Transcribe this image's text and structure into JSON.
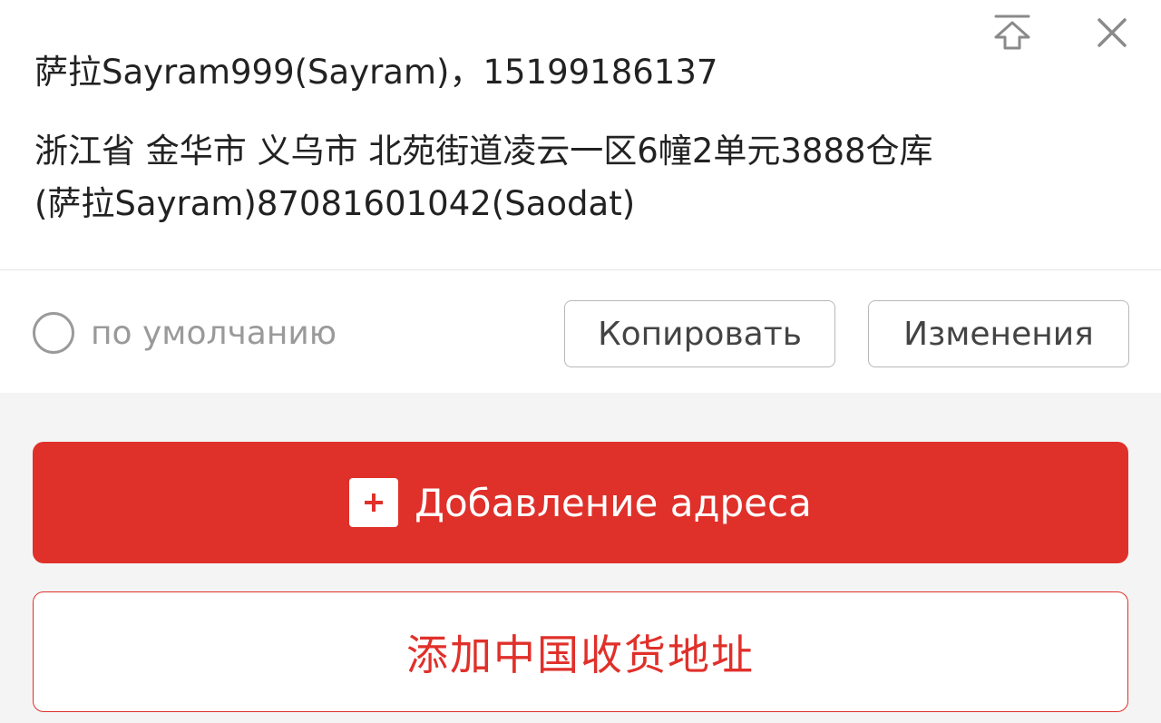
{
  "address_card": {
    "contact": "萨拉Sayram999(Sayram)，15199186137",
    "address_lines": [
      "浙江省 金华市 义乌市 北苑街道凌云一区6幢2单元3888仓库",
      "(萨拉Sayram)87081601042(Saodat)"
    ],
    "default_label": "по умолчанию",
    "default_checked": false,
    "copy_label": "Копировать",
    "edit_label": "Изменения"
  },
  "icons": {
    "top": "pin-to-top-icon",
    "close": "close-icon",
    "plus": "plus-icon"
  },
  "buttons": {
    "add_address_label": "Добавление адреса",
    "add_china_address_label": "添加中国收货地址"
  },
  "colors": {
    "accent": "#e0302a",
    "text_primary": "#222222",
    "text_muted": "#9a9a9a",
    "icon_gray": "#8a8a8a",
    "background": "#f4f4f4"
  }
}
